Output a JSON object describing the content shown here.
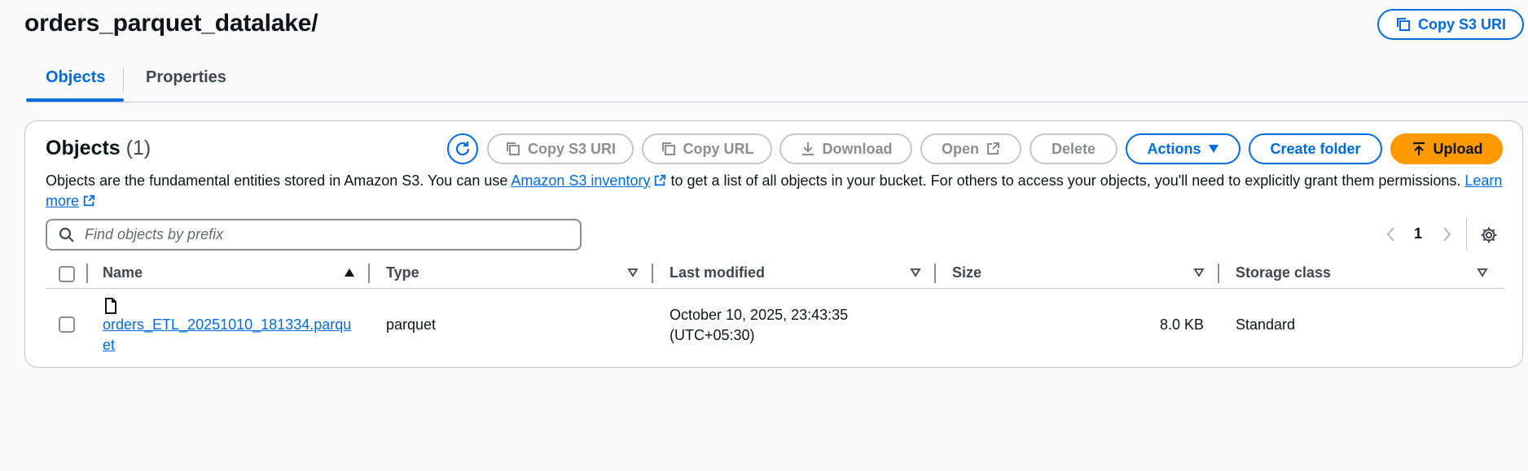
{
  "header": {
    "title": "orders_parquet_datalake/",
    "copy_s3_uri_label": "Copy S3 URI"
  },
  "tabs": [
    {
      "label": "Objects",
      "active": true
    },
    {
      "label": "Properties",
      "active": false
    }
  ],
  "objects": {
    "title": "Objects",
    "count": "(1)",
    "toolbar": {
      "copy_s3_uri": "Copy S3 URI",
      "copy_url": "Copy URL",
      "download": "Download",
      "open": "Open",
      "delete": "Delete",
      "actions": "Actions",
      "create_folder": "Create folder",
      "upload": "Upload"
    },
    "description": {
      "part1": "Objects are the fundamental entities stored in Amazon S3. You can use ",
      "link1": "Amazon S3 inventory",
      "part2": " to get a list of all objects in your bucket. For others to access your objects, you'll need to explicitly grant them permissions. ",
      "link2": "Learn more"
    },
    "search": {
      "placeholder": "Find objects by prefix",
      "value": ""
    },
    "pagination": {
      "current_page": "1"
    },
    "columns": [
      "Name",
      "Type",
      "Last modified",
      "Size",
      "Storage class"
    ],
    "rows": [
      {
        "name": "orders_ETL_20251010_181334.parquet",
        "type": "parquet",
        "last_modified": "October 10, 2025, 23:43:35 (UTC+05:30)",
        "size": "8.0 KB",
        "storage_class": "Standard"
      }
    ]
  },
  "colors": {
    "accent": "#006ce0",
    "upload": "#ff9900",
    "disabled": "#8c8c94"
  }
}
